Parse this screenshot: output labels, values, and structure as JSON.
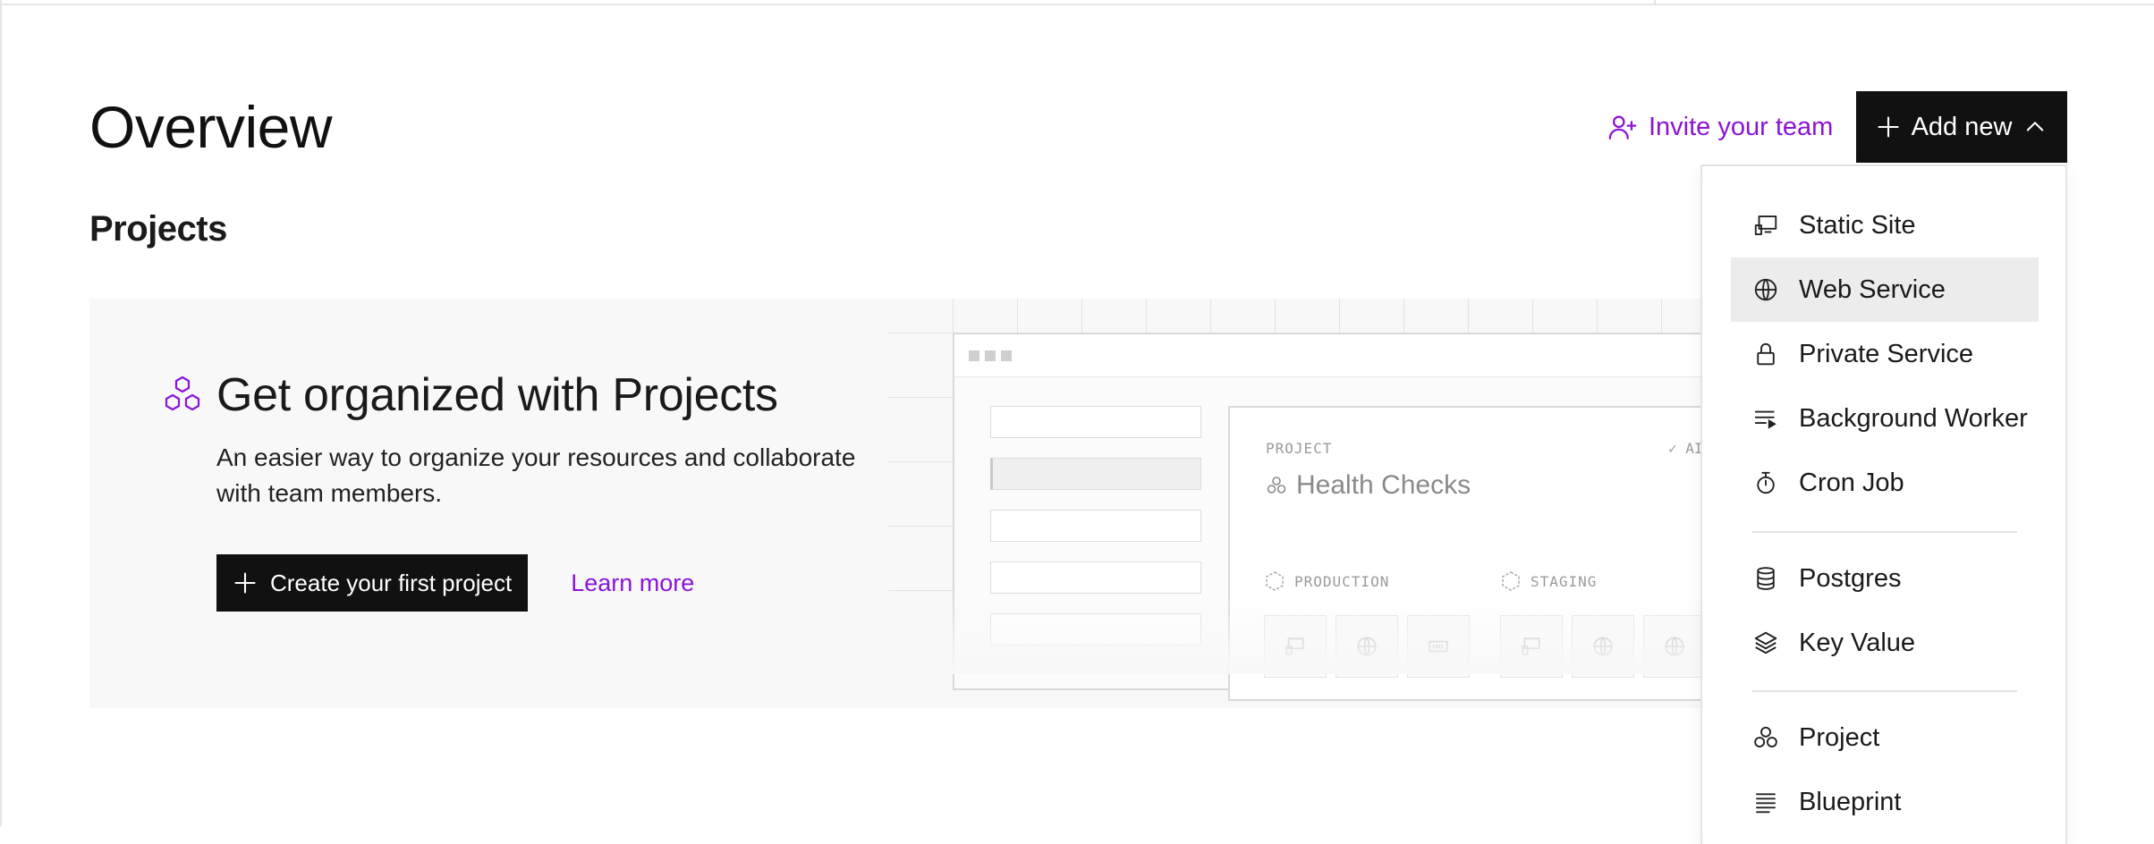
{
  "header": {
    "title": "Overview",
    "invite_label": "Invite your team",
    "add_label": "Add new"
  },
  "projects": {
    "section_title": "Projects",
    "banner": {
      "heading": "Get organized with Projects",
      "description": "An easier way to organize your resources and collaborate with team members.",
      "create_label": "Create your first project",
      "learn_label": "Learn more"
    },
    "illustration": {
      "card_label": "PROJECT",
      "card_title": "Health Checks",
      "card_status": "✓ AI",
      "env_1": "PRODUCTION",
      "env_2": "STAGING"
    }
  },
  "menu": {
    "items": [
      {
        "label": "Static Site",
        "icon": "static-site-icon"
      },
      {
        "label": "Web Service",
        "icon": "globe-icon",
        "active": true
      },
      {
        "label": "Private Service",
        "icon": "lock-icon"
      },
      {
        "label": "Background Worker",
        "icon": "worker-list-icon"
      },
      {
        "label": "Cron Job",
        "icon": "stopwatch-icon"
      },
      {
        "label": "Postgres",
        "icon": "database-icon"
      },
      {
        "label": "Key Value",
        "icon": "layers-icon"
      },
      {
        "label": "Project",
        "icon": "project-icon"
      },
      {
        "label": "Blueprint",
        "icon": "blueprint-icon"
      }
    ]
  },
  "colors": {
    "accent": "#8a14d6",
    "primary_button": "#111111",
    "banner_bg": "#f8f8f8",
    "active_item_bg": "#ececec"
  }
}
